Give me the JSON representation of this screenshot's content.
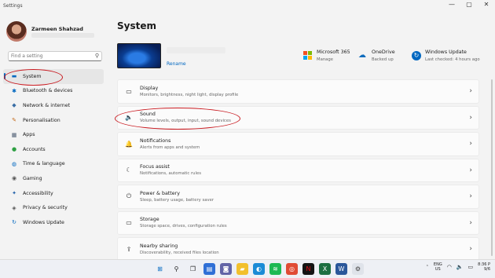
{
  "window": {
    "title": "Settings",
    "controls": [
      "—",
      "▢",
      "✕"
    ]
  },
  "user": {
    "name": "Zarmeen Shahzad"
  },
  "search": {
    "placeholder": "Find a setting",
    "value": "Find a setting"
  },
  "sidebar": {
    "items": [
      {
        "label": "System",
        "icon": "display-icon",
        "glyph": "▬",
        "color": "#0067c0",
        "active": true
      },
      {
        "label": "Bluetooth & devices",
        "icon": "bluetooth-icon",
        "glyph": "✱",
        "color": "#0067c0"
      },
      {
        "label": "Network & internet",
        "icon": "network-icon",
        "glyph": "◆",
        "color": "#3a6ea5"
      },
      {
        "label": "Personalisation",
        "icon": "brush-icon",
        "glyph": "✎",
        "color": "#c46a1a"
      },
      {
        "label": "Apps",
        "icon": "apps-icon",
        "glyph": "▦",
        "color": "#4a5a70"
      },
      {
        "label": "Accounts",
        "icon": "accounts-icon",
        "glyph": "●",
        "color": "#2ea043"
      },
      {
        "label": "Time & language",
        "icon": "globe-icon",
        "glyph": "◍",
        "color": "#0067c0"
      },
      {
        "label": "Gaming",
        "icon": "gaming-icon",
        "glyph": "◉",
        "color": "#555555"
      },
      {
        "label": "Accessibility",
        "icon": "accessibility-icon",
        "glyph": "✦",
        "color": "#1f5fa8"
      },
      {
        "label": "Privacy & security",
        "icon": "shield-icon",
        "glyph": "◈",
        "color": "#555555"
      },
      {
        "label": "Windows Update",
        "icon": "update-icon",
        "glyph": "↻",
        "color": "#0067c0"
      }
    ]
  },
  "main": {
    "title": "System",
    "rename": "Rename",
    "quick": [
      {
        "title": "Microsoft 365",
        "sub": "Manage",
        "icon": "microsoft-logo-icon"
      },
      {
        "title": "OneDrive",
        "sub": "Backed up",
        "icon": "cloud-icon"
      },
      {
        "title": "Windows Update",
        "sub": "Last checked: 4 hours ago",
        "icon": "update-icon"
      }
    ],
    "cards": [
      {
        "title": "Display",
        "sub": "Monitors, brightness, night light, display profile",
        "icon": "monitor-icon",
        "glyph": "▭"
      },
      {
        "title": "Sound",
        "sub": "Volume levels, output, input, sound devices",
        "icon": "speaker-icon",
        "glyph": "🔈"
      },
      {
        "title": "Notifications",
        "sub": "Alerts from apps and system",
        "icon": "bell-icon",
        "glyph": "🔔"
      },
      {
        "title": "Focus assist",
        "sub": "Notifications, automatic rules",
        "icon": "moon-icon",
        "glyph": "☾"
      },
      {
        "title": "Power & battery",
        "sub": "Sleep, battery usage, battery saver",
        "icon": "power-icon",
        "glyph": "⏻"
      },
      {
        "title": "Storage",
        "sub": "Storage space, drives, configuration rules",
        "icon": "storage-icon",
        "glyph": "▭"
      },
      {
        "title": "Nearby sharing",
        "sub": "Discoverability, received files location",
        "icon": "share-icon",
        "glyph": "⇪"
      }
    ]
  },
  "taskbar": {
    "apps": [
      {
        "name": "start-button",
        "glyph": "⊞",
        "bg": "transparent",
        "fg": "#0067c0"
      },
      {
        "name": "search-taskbar-icon",
        "glyph": "⚲",
        "bg": "transparent",
        "fg": "#222"
      },
      {
        "name": "task-view-icon",
        "glyph": "❐",
        "bg": "transparent",
        "fg": "#222"
      },
      {
        "name": "widgets-icon",
        "glyph": "▤",
        "bg": "#2f6fd6",
        "fg": "#fff"
      },
      {
        "name": "teams-icon",
        "glyph": "◙",
        "bg": "#6264a7",
        "fg": "#fff"
      },
      {
        "name": "file-explorer-icon",
        "glyph": "▰",
        "bg": "#f2c02d",
        "fg": "#fff"
      },
      {
        "name": "edge-icon",
        "glyph": "◐",
        "bg": "#1b8bd6",
        "fg": "#fff"
      },
      {
        "name": "spotify-icon",
        "glyph": "≋",
        "bg": "#1db954",
        "fg": "#fff"
      },
      {
        "name": "chrome-icon",
        "glyph": "◎",
        "bg": "#e04b35",
        "fg": "#fff"
      },
      {
        "name": "netflix-icon",
        "glyph": "N",
        "bg": "#141414",
        "fg": "#e50914"
      },
      {
        "name": "excel-icon",
        "glyph": "X",
        "bg": "#1d6f42",
        "fg": "#fff"
      },
      {
        "name": "word-icon",
        "glyph": "W",
        "bg": "#2b579a",
        "fg": "#fff"
      },
      {
        "name": "settings-taskbar-icon",
        "glyph": "⚙",
        "bg": "#dfe3ea",
        "fg": "#444"
      }
    ],
    "lang_top": "ENG",
    "lang_bottom": "US",
    "time": "8:36 P",
    "date": "9/6"
  },
  "colors": {
    "accent": "#0067c0",
    "annotation": "#c8181e"
  }
}
